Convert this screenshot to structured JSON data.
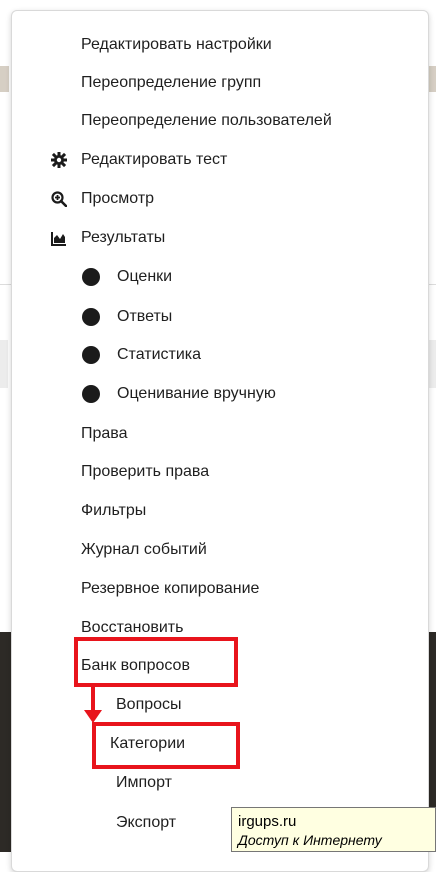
{
  "menu": {
    "items": [
      {
        "label": "Редактировать настройки",
        "icon": null
      },
      {
        "label": "Переопределение групп",
        "icon": null
      },
      {
        "label": "Переопределение пользователей",
        "icon": null
      },
      {
        "label": "Редактировать тест",
        "icon": "gear-icon"
      },
      {
        "label": "Просмотр",
        "icon": "zoom-in-icon"
      },
      {
        "label": "Результаты",
        "icon": "area-chart-icon"
      },
      {
        "label": "Оценки",
        "icon": "bullet-dot-icon"
      },
      {
        "label": "Ответы",
        "icon": "bullet-dot-icon"
      },
      {
        "label": "Статистика",
        "icon": "bullet-dot-icon"
      },
      {
        "label": "Оценивание вручную",
        "icon": "bullet-dot-icon"
      },
      {
        "label": "Права",
        "icon": null
      },
      {
        "label": "Проверить права",
        "icon": null
      },
      {
        "label": "Фильтры",
        "icon": null
      },
      {
        "label": "Журнал событий",
        "icon": null
      },
      {
        "label": "Резервное копирование",
        "icon": null
      },
      {
        "label": "Восстановить",
        "icon": null
      },
      {
        "label": "Банк вопросов",
        "icon": null
      },
      {
        "label": "Вопросы",
        "icon": null
      },
      {
        "label": "Категории",
        "icon": null
      },
      {
        "label": "Импорт",
        "icon": null
      },
      {
        "label": "Экспорт",
        "icon": null
      }
    ]
  },
  "annotations": {
    "highlight_color": "#e8141c",
    "highlighted_items": [
      "Банк вопросов",
      "Категории"
    ]
  },
  "tooltip": {
    "site": "irgups.ru",
    "status": "Доступ к Интернету"
  }
}
